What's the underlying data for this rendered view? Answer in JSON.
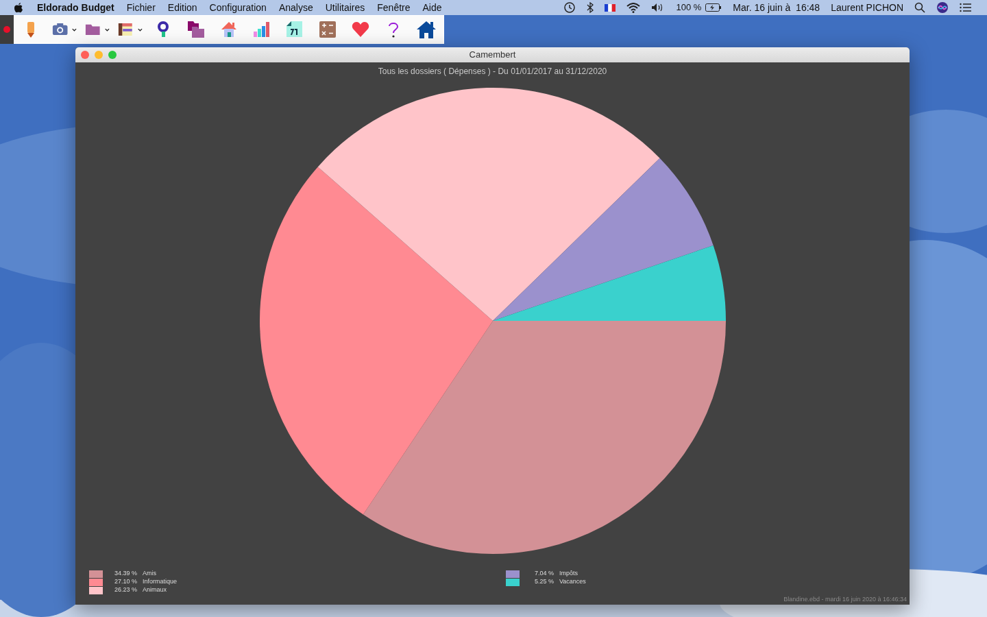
{
  "menu_bar": {
    "app_name": "Eldorado Budget",
    "menus": [
      "Fichier",
      "Edition",
      "Configuration",
      "Analyse",
      "Utilitaires",
      "Fenêtre",
      "Aide"
    ],
    "battery": "100 %",
    "clock": "Mar. 16 juin à  16:48",
    "user": "Laurent PICHON"
  },
  "window": {
    "title": "Camembert",
    "subtitle": "Tous les dossiers ( Dépenses ) - Du 01/01/2017 au 31/12/2020",
    "footer": "Blandine.ebd - mardi 16 juin 2020 à 16:46:34"
  },
  "chart_data": {
    "type": "pie",
    "categories": [
      "Amis",
      "Informatique",
      "Animaux",
      "Impôts",
      "Vacances"
    ],
    "values": [
      34.39,
      27.1,
      26.23,
      7.04,
      5.25
    ]
  },
  "legend": [
    [
      {
        "percent": "34.39 %",
        "color": "#d39196"
      },
      {
        "percent": "27.10 %",
        "color": "#ff8a92"
      },
      {
        "percent": "26.23 %",
        "color": "#ffc4c9"
      }
    ],
    [
      {
        "percent": "7.04 %",
        "color": "#9b91cd"
      },
      {
        "percent": "5.25 %",
        "color": "#3ad1cd"
      }
    ]
  ]
}
